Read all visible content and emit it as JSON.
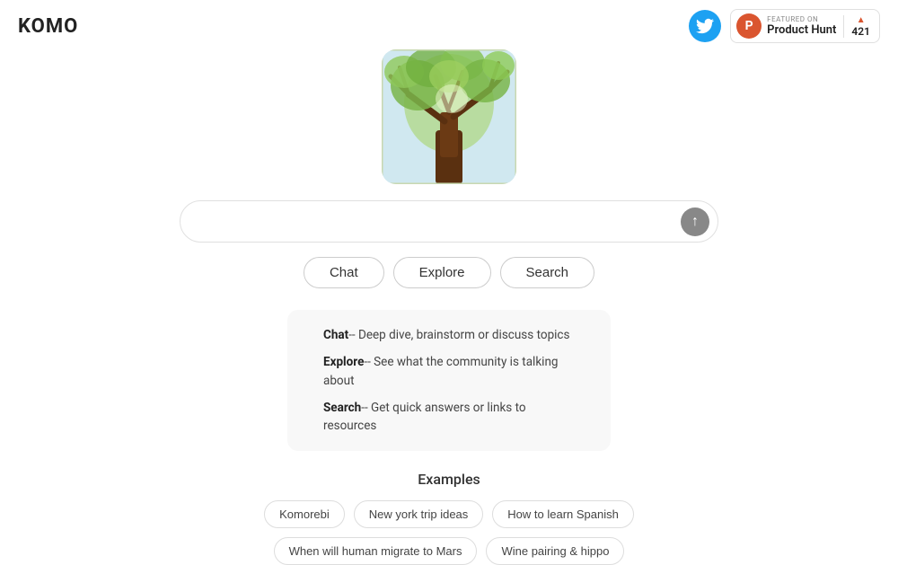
{
  "header": {
    "logo": "KOMO",
    "twitter_label": "Twitter",
    "product_hunt": {
      "featured_label": "FEATURED ON",
      "name": "Product Hunt",
      "count": "421",
      "icon_letter": "P"
    }
  },
  "search": {
    "placeholder": "",
    "submit_icon": "↑"
  },
  "tabs": [
    {
      "label": "Chat",
      "id": "chat"
    },
    {
      "label": "Explore",
      "id": "explore"
    },
    {
      "label": "Search",
      "id": "search"
    }
  ],
  "info": {
    "chat": {
      "label": "Chat",
      "description": "-- Deep dive, brainstorm or discuss topics"
    },
    "explore": {
      "label": "Explore",
      "description": "-- See what the community is talking about"
    },
    "search": {
      "label": "Search",
      "description": "-- Get quick answers or links to resources"
    }
  },
  "examples": {
    "title": "Examples",
    "chips": [
      "Komorebi",
      "New york trip ideas",
      "How to learn Spanish",
      "When will human migrate to Mars",
      "Wine pairing & hippo"
    ]
  }
}
